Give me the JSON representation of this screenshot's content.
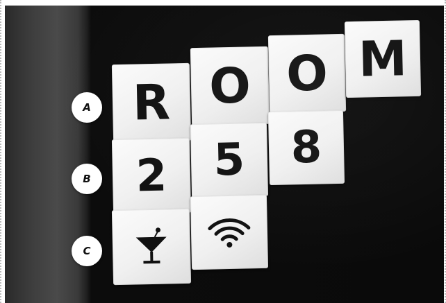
{
  "tiles": {
    "row1": [
      "R",
      "O",
      "O",
      "M"
    ],
    "row2": [
      "2",
      "5",
      "8"
    ],
    "row3_icons": [
      "cocktail-icon",
      "wifi-icon"
    ]
  },
  "labels": [
    "A",
    "B",
    "C"
  ],
  "colors": {
    "tile": "#f2f2f2",
    "glyph": "#101010",
    "wall": "#0a0a0a",
    "badge": "#ffffff"
  }
}
